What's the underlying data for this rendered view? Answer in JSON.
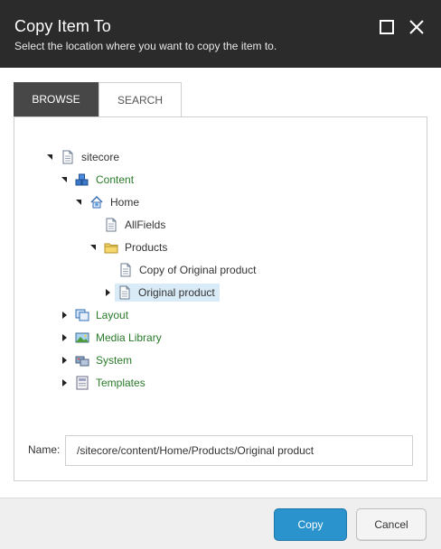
{
  "dialog": {
    "title": "Copy Item To",
    "subtitle": "Select the location where you want to copy the item to.",
    "maximize_icon": "maximize-icon",
    "close_icon": "close-icon"
  },
  "tabs": [
    {
      "label": "BROWSE",
      "active": true
    },
    {
      "label": "SEARCH",
      "active": false
    }
  ],
  "tree": {
    "nodes": [
      {
        "label": "sitecore",
        "icon": "document-icon",
        "expanded": true,
        "depth": 0
      },
      {
        "label": "Content",
        "icon": "content-cubes-icon",
        "expanded": true,
        "depth": 1
      },
      {
        "label": "Home",
        "icon": "home-icon",
        "expanded": true,
        "depth": 2
      },
      {
        "label": "AllFields",
        "icon": "document-icon",
        "expanded": null,
        "depth": 3
      },
      {
        "label": "Products",
        "icon": "folder-icon",
        "expanded": true,
        "depth": 3
      },
      {
        "label": "Copy of Original product",
        "icon": "document-icon",
        "expanded": null,
        "depth": 4
      },
      {
        "label": "Original product",
        "icon": "document-icon",
        "expanded": false,
        "depth": 4,
        "selected": true
      },
      {
        "label": "Layout",
        "icon": "layout-icon",
        "expanded": false,
        "depth": 1
      },
      {
        "label": "Media Library",
        "icon": "media-library-icon",
        "expanded": false,
        "depth": 1
      },
      {
        "label": "System",
        "icon": "system-icon",
        "expanded": false,
        "depth": 1
      },
      {
        "label": "Templates",
        "icon": "templates-icon",
        "expanded": false,
        "depth": 1
      }
    ]
  },
  "name_field": {
    "label": "Name:",
    "value": "/sitecore/content/Home/Products/Original product"
  },
  "buttons": {
    "copy_label": "Copy",
    "cancel_label": "Cancel"
  },
  "colors": {
    "titlebar": "#2b2b2b",
    "tab_active": "#474747",
    "tree_green": "#2a7a2a",
    "selected_bg": "#d8ebf7",
    "primary_button": "#2a93cd"
  }
}
